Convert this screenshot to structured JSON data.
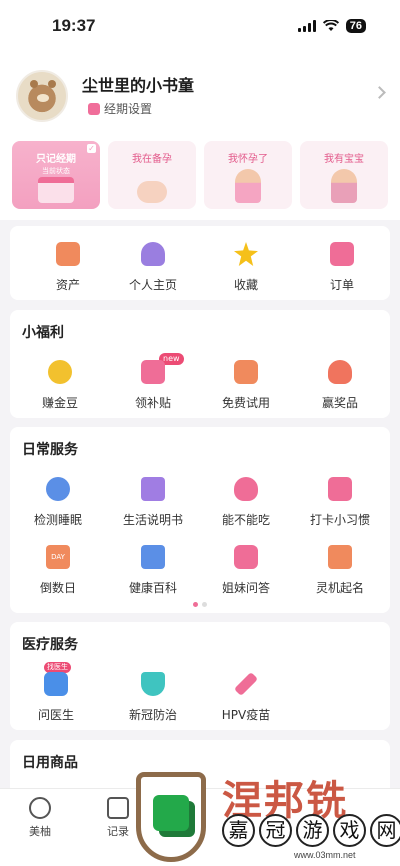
{
  "status": {
    "time": "19:37",
    "battery": "76"
  },
  "profile": {
    "username": "尘世里的小书童",
    "period_setting": "经期设置"
  },
  "modes": [
    {
      "label": "只记经期",
      "sub": "当前状态"
    },
    {
      "label": "我在备孕"
    },
    {
      "label": "我怀孕了"
    },
    {
      "label": "我有宝宝"
    }
  ],
  "quick": [
    {
      "label": "资产",
      "color": "#f08a5d"
    },
    {
      "label": "个人主页",
      "color": "#9a7ee0"
    },
    {
      "label": "收藏",
      "color": "#f5c01a"
    },
    {
      "label": "订单",
      "color": "#ef6d97"
    }
  ],
  "welfare": {
    "title": "小福利",
    "new_badge": "new",
    "items": [
      {
        "label": "赚金豆",
        "color": "#f2c12e"
      },
      {
        "label": "领补贴",
        "color": "#ef6d97"
      },
      {
        "label": "免费试用",
        "color": "#f08a5d"
      },
      {
        "label": "赢奖品",
        "color": "#f0745e"
      }
    ]
  },
  "daily": {
    "title": "日常服务",
    "items": [
      {
        "label": "检测睡眠",
        "color": "#5b8fe6"
      },
      {
        "label": "生活说明书",
        "color": "#a07de3"
      },
      {
        "label": "能不能吃",
        "color": "#ef6d97"
      },
      {
        "label": "打卡小习惯",
        "color": "#ef6d97"
      },
      {
        "label": "倒数日",
        "color": "#f08a5d",
        "icon_text": "DAY"
      },
      {
        "label": "健康百科",
        "color": "#5b8fe6"
      },
      {
        "label": "姐妹问答",
        "color": "#ef6d97"
      },
      {
        "label": "灵机起名",
        "color": "#f08a5d"
      }
    ]
  },
  "medical": {
    "title": "医疗服务",
    "tag": "找医生",
    "items": [
      {
        "label": "问医生",
        "color": "#4a8fe8"
      },
      {
        "label": "新冠防治",
        "color": "#3fc4c0"
      },
      {
        "label": "HPV疫苗",
        "color": "#ef6d97"
      }
    ]
  },
  "goods": {
    "title": "日用商品"
  },
  "tabs": [
    {
      "label": "美柚"
    },
    {
      "label": "记录"
    }
  ],
  "watermark": {
    "chars": [
      "嘉",
      "冠",
      "游",
      "戏",
      "网"
    ],
    "url": "www.03mm.net"
  }
}
